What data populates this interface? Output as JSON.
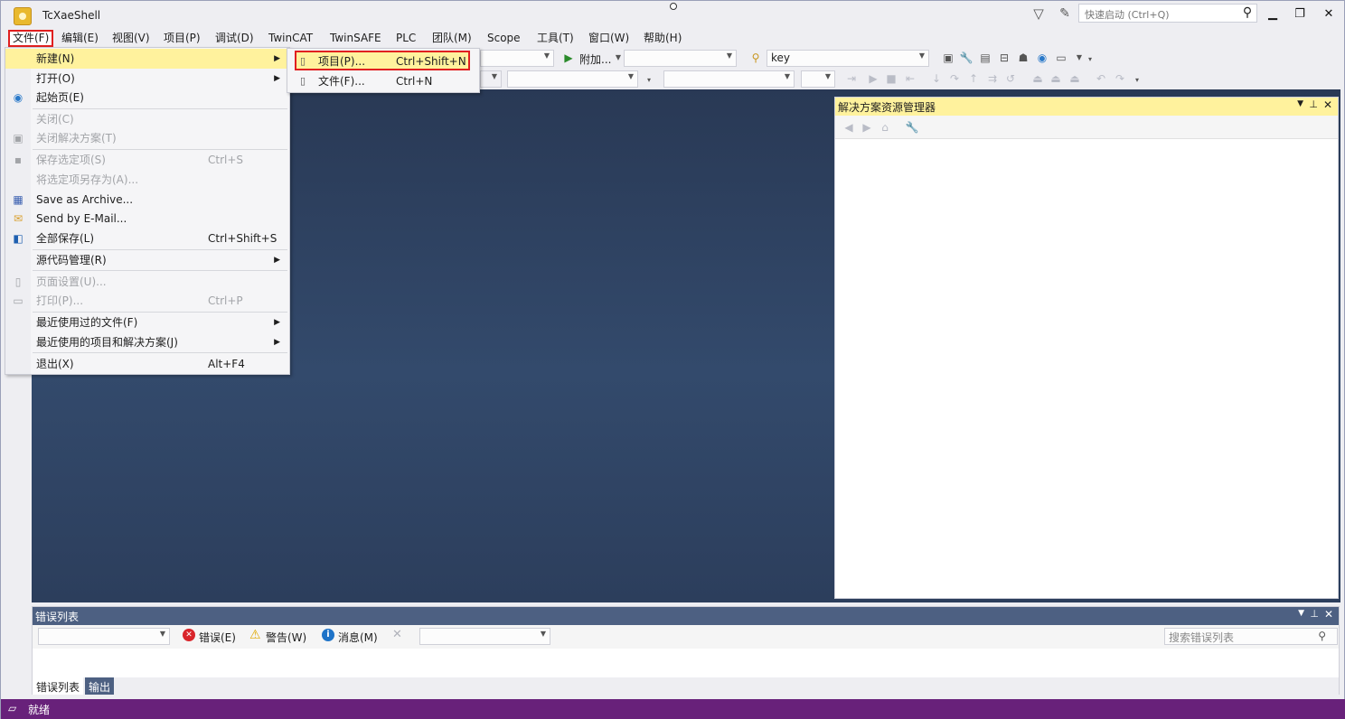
{
  "window": {
    "title": "TcXaeShell",
    "quick_launch_placeholder": "快速启动 (Ctrl+Q)",
    "minimize": "▁",
    "restore": "❐",
    "close": "✕"
  },
  "menubar": [
    "文件(F)",
    "编辑(E)",
    "视图(V)",
    "项目(P)",
    "调试(D)",
    "TwinCAT",
    "TwinSAFE",
    "PLC",
    "团队(M)",
    "Scope",
    "工具(T)",
    "窗口(W)",
    "帮助(H)"
  ],
  "toolbar": {
    "attach_label": "附加...",
    "search_combo_value": "key"
  },
  "file_menu": {
    "items": [
      {
        "label": "新建(N)",
        "shortcut": "",
        "submenu": true,
        "disabled": false,
        "highlighted": true
      },
      {
        "label": "打开(O)",
        "shortcut": "",
        "submenu": true,
        "disabled": false
      },
      {
        "label": "起始页(E)",
        "shortcut": "",
        "submenu": false,
        "disabled": false
      },
      {
        "label": "关闭(C)",
        "shortcut": "",
        "submenu": false,
        "disabled": true
      },
      {
        "label": "关闭解决方案(T)",
        "shortcut": "",
        "submenu": false,
        "disabled": true
      },
      {
        "label": "保存选定项(S)",
        "shortcut": "Ctrl+S",
        "submenu": false,
        "disabled": true
      },
      {
        "label": "将选定项另存为(A)...",
        "shortcut": "",
        "submenu": false,
        "disabled": true
      },
      {
        "label": "Save  as Archive...",
        "shortcut": "",
        "submenu": false,
        "disabled": false
      },
      {
        "label": "Send  by E-Mail...",
        "shortcut": "",
        "submenu": false,
        "disabled": false
      },
      {
        "label": "全部保存(L)",
        "shortcut": "Ctrl+Shift+S",
        "submenu": false,
        "disabled": false
      },
      {
        "label": "源代码管理(R)",
        "shortcut": "",
        "submenu": true,
        "disabled": false
      },
      {
        "label": "页面设置(U)...",
        "shortcut": "",
        "submenu": false,
        "disabled": true
      },
      {
        "label": "打印(P)...",
        "shortcut": "Ctrl+P",
        "submenu": false,
        "disabled": true
      },
      {
        "label": "最近使用过的文件(F)",
        "shortcut": "",
        "submenu": true,
        "disabled": false
      },
      {
        "label": "最近使用的项目和解决方案(J)",
        "shortcut": "",
        "submenu": true,
        "disabled": false
      },
      {
        "label": "退出(X)",
        "shortcut": "Alt+F4",
        "submenu": false,
        "disabled": false
      }
    ]
  },
  "new_submenu": {
    "items": [
      {
        "label": "项目(P)...",
        "shortcut": "Ctrl+Shift+N"
      },
      {
        "label": "文件(F)...",
        "shortcut": "Ctrl+N"
      }
    ]
  },
  "solution_explorer": {
    "title": "解决方案资源管理器"
  },
  "error_list": {
    "title": "错误列表",
    "errors_label": "错误(E)",
    "warnings_label": "警告(W)",
    "messages_label": "消息(M)",
    "search_placeholder": "搜索错误列表",
    "tabs": [
      "错误列表",
      "输出"
    ]
  },
  "status": {
    "text": "就绪"
  },
  "colors": {
    "highlight": "#fff29d",
    "callout_border": "#e02020",
    "status_bar": "#68217a"
  }
}
